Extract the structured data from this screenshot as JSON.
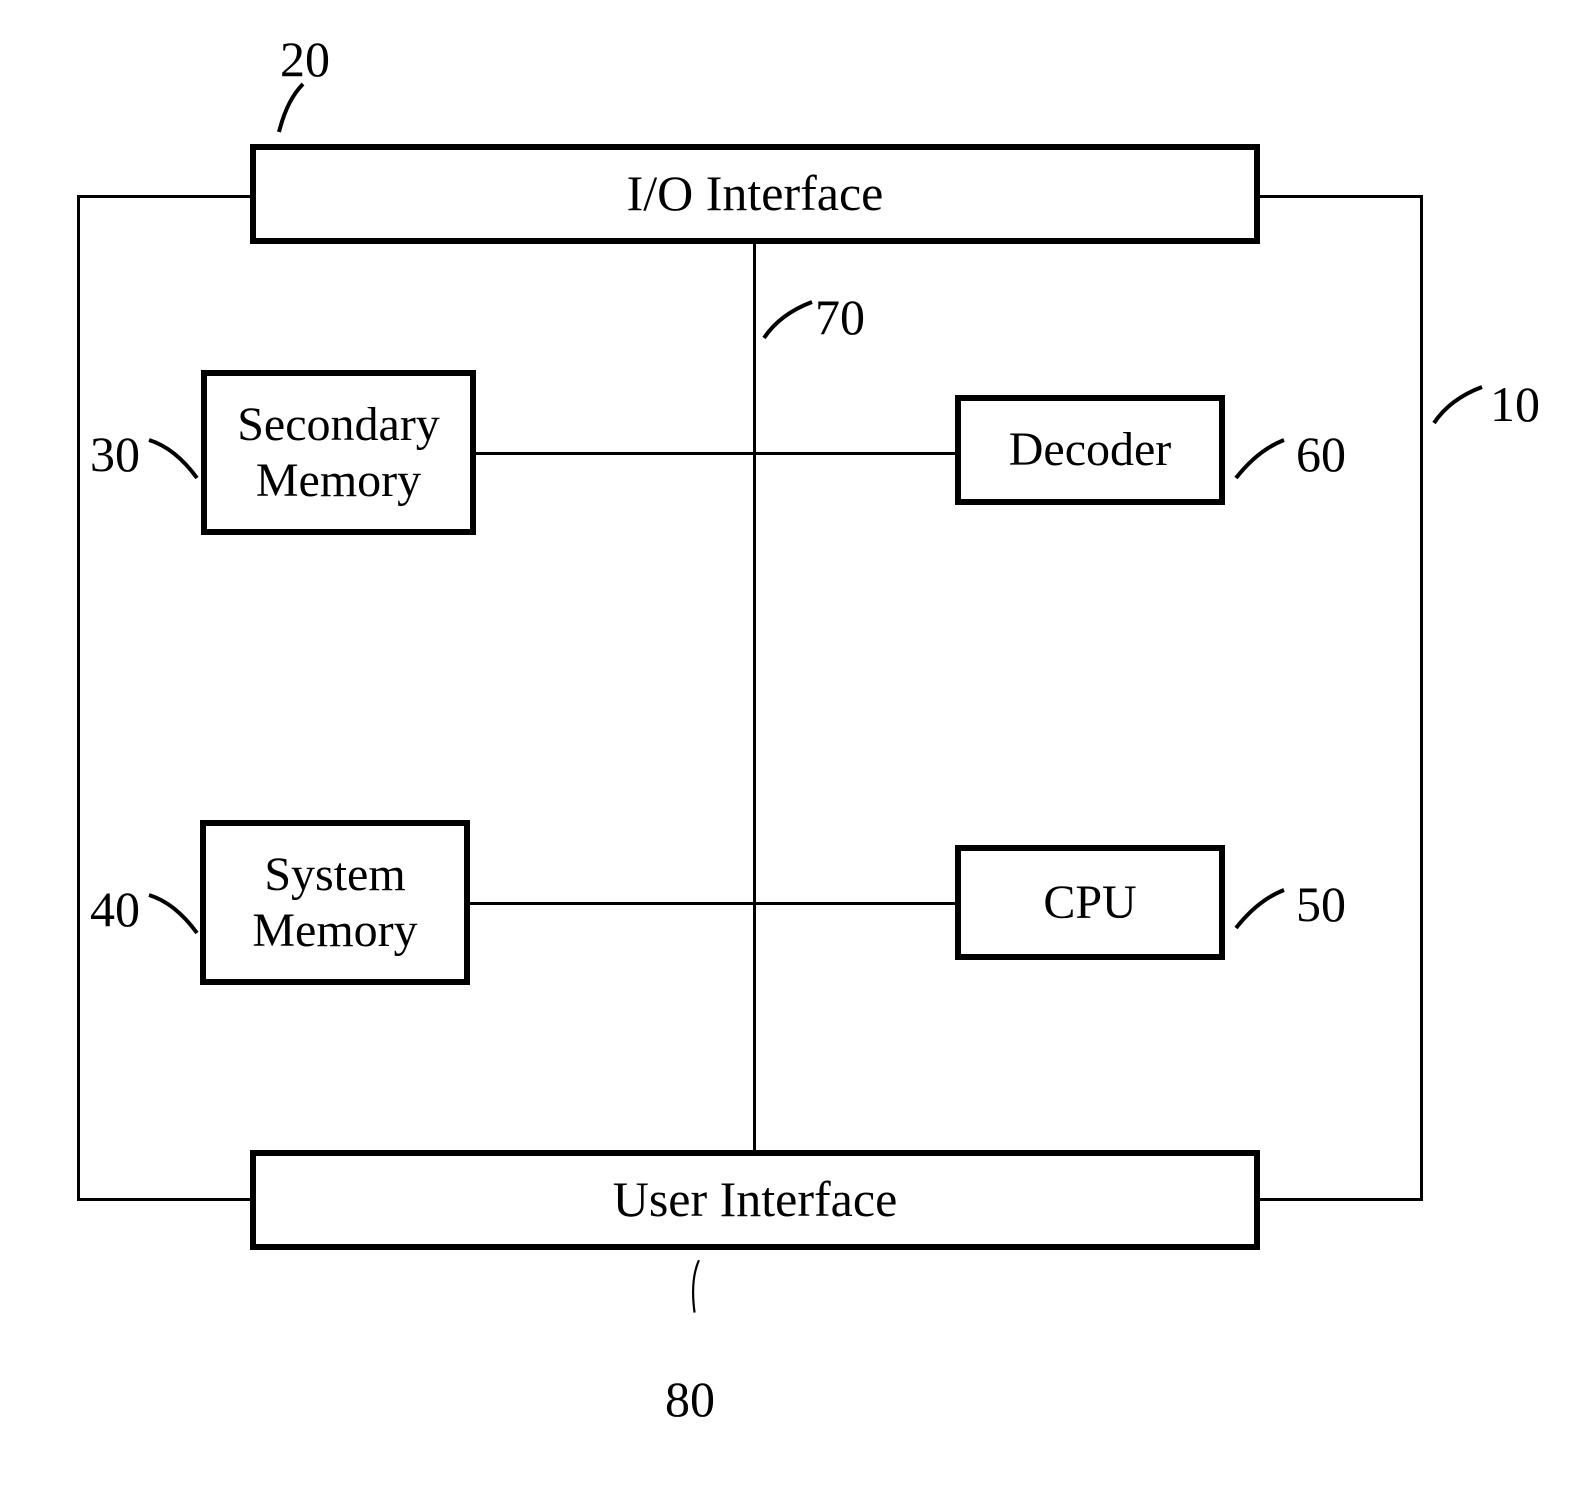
{
  "blocks": {
    "io_interface": "I/O Interface",
    "secondary_memory": "Secondary\nMemory",
    "decoder": "Decoder",
    "system_memory": "System\nMemory",
    "cpu": "CPU",
    "user_interface": "User Interface"
  },
  "refs": {
    "r10": "10",
    "r20": "20",
    "r30": "30",
    "r40": "40",
    "r50": "50",
    "r60": "60",
    "r70": "70",
    "r80": "80"
  }
}
